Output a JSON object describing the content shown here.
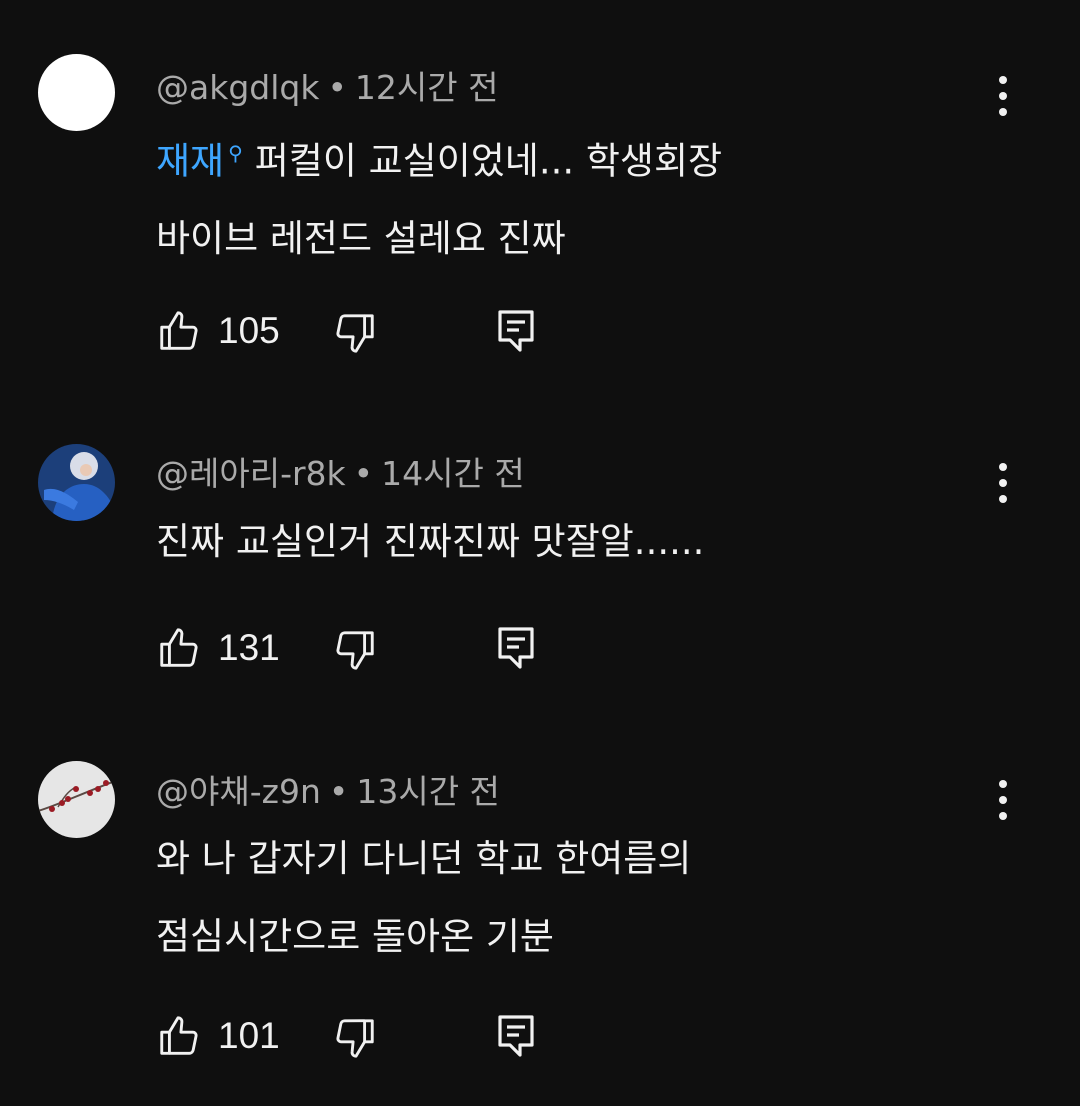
{
  "comments": [
    {
      "author": "@akgdlqk",
      "separator": "•",
      "time": "12시간 전",
      "mention": "재재",
      "text_line1": "퍼컬이 교실이었네... 학생회장",
      "text_line2": "바이브 레전드 설레요 진짜",
      "likes": "105",
      "avatar_color": "#ffffff"
    },
    {
      "author": "@레아리-r8k",
      "separator": "•",
      "time": "14시간 전",
      "text_line1": "진짜 교실인거 진짜진짜 맛잘알......",
      "likes": "131"
    },
    {
      "author": "@야채-z9n",
      "separator": "•",
      "time": "13시간 전",
      "text_line1": "와 나 갑자기 다니던 학교 한여름의",
      "text_line2": "점심시간으로 돌아온 기분",
      "likes": "101"
    }
  ],
  "icons": {
    "like": "thumbs-up-icon",
    "dislike": "thumbs-down-icon",
    "reply": "reply-comment-icon",
    "more": "more-vertical-icon",
    "mention": "mention-badge-icon"
  },
  "colors": {
    "background": "#0f0f0f",
    "text": "#f1f1f1",
    "meta": "#aaaaaa",
    "mention": "#3ea6ff"
  }
}
